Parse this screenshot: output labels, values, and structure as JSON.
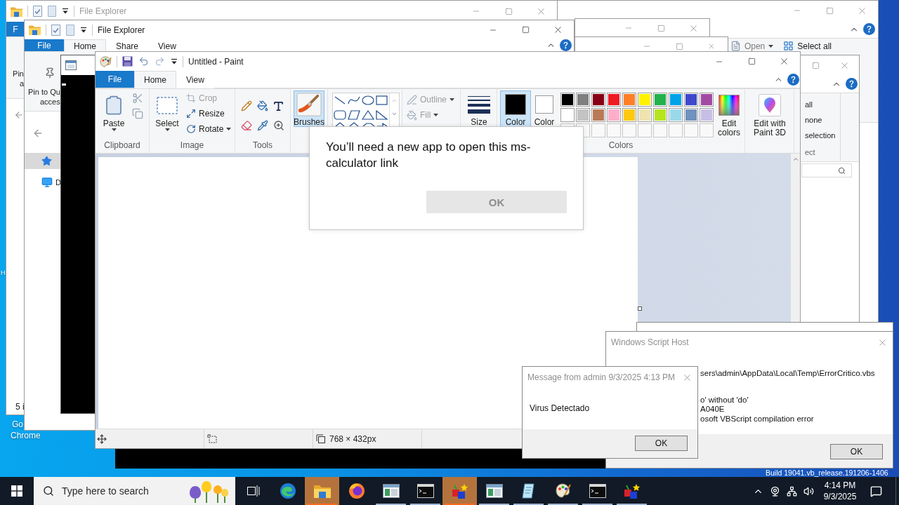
{
  "desktop": {
    "icon_labels": [
      {
        "lines": [
          "H"
        ]
      },
      {
        "lines": [
          "Go",
          "Chrome"
        ]
      }
    ],
    "build": "Build 19041.vb_release.191206-1406"
  },
  "explorer_right": {
    "ribbon": [
      {
        "kind": "open",
        "label": "Open",
        "disabled": true
      },
      {
        "kind": "select_all",
        "label": "Select all",
        "disabled": false
      }
    ]
  },
  "explorer_back": {
    "title": "File Explorer",
    "file_tab": "F",
    "pin_label": [
      "Pin",
      "a"
    ],
    "status": "5 i"
  },
  "explorer_side": {
    "select_items": [
      "all",
      "none",
      "selection"
    ],
    "group_label": "ect"
  },
  "explorer_front": {
    "title": "File Explorer",
    "file_tab": "File",
    "tabs": [
      {
        "label": "Home",
        "selected": true
      },
      {
        "label": "Share",
        "selected": false
      },
      {
        "label": "View",
        "selected": false
      }
    ],
    "pin_label": [
      "Pin to Qu",
      "acces"
    ],
    "nav_items": [
      {
        "kind": "quick_access",
        "selected": true
      },
      {
        "kind": "desktop",
        "label": "D",
        "selected": false
      }
    ]
  },
  "paint": {
    "title": "Untitled - Paint",
    "file_tab": "File",
    "tabs": [
      {
        "label": "Home",
        "selected": true
      },
      {
        "label": "View",
        "selected": false
      }
    ],
    "clipboard": {
      "paste": "Paste",
      "label": "Clipboard"
    },
    "image": {
      "select": "Select",
      "items": [
        {
          "kind": "crop",
          "label": "Crop",
          "disabled": true
        },
        {
          "kind": "resize",
          "label": "Resize",
          "disabled": false
        },
        {
          "kind": "rotate",
          "label": "Rotate",
          "disabled": false
        }
      ],
      "label": "Image"
    },
    "tools_label": "Tools",
    "brushes": {
      "label": "Brushes",
      "selected": true
    },
    "shape_options": [
      {
        "kind": "outline",
        "label": "Outline",
        "disabled": true
      },
      {
        "kind": "fill",
        "label": "Fill",
        "disabled": true
      }
    ],
    "size": "Size",
    "color_slots": [
      {
        "label": "Color",
        "selected": true,
        "color": "#000000"
      },
      {
        "label": "Color",
        "selected": false,
        "color": "#ffffff"
      }
    ],
    "palette": [
      {
        "color": "#000000"
      },
      {
        "color": "#7f7f7f"
      },
      {
        "color": "#880015"
      },
      {
        "color": "#ed1c24"
      },
      {
        "color": "#ff7f27"
      },
      {
        "color": "#fff200"
      },
      {
        "color": "#22b14c"
      },
      {
        "color": "#00a2e8"
      },
      {
        "color": "#3f48cc"
      },
      {
        "color": "#a349a4"
      },
      {
        "color": "#ffffff"
      },
      {
        "color": "#c3c3c3"
      },
      {
        "color": "#b97a57"
      },
      {
        "color": "#ffaec9"
      },
      {
        "color": "#ffc90e"
      },
      {
        "color": "#efe4b0"
      },
      {
        "color": "#b5e61d"
      },
      {
        "color": "#99d9ea"
      },
      {
        "color": "#7092be"
      },
      {
        "color": "#c8bfe7"
      }
    ],
    "colors_label": "Colors",
    "edit_colors": "Edit colors",
    "paint3d": "Edit with Paint 3D",
    "status_size": "768 × 432px"
  },
  "app_dialog": {
    "message": "You’ll need a new app to open this ms-calculator link",
    "button": "OK"
  },
  "script_host": {
    "title": "Windows Script Host",
    "lines": [
      "sers\\admin\\AppData\\Local\\Temp\\ErrorCritico.vbs",
      "o' without 'do'",
      "A040E",
      "osoft VBScript compilation error"
    ],
    "button": "OK"
  },
  "message_box": {
    "title": "Message from admin 9/3/2025 4:13 PM",
    "text": "Virus Detectado",
    "button": "OK"
  },
  "taskbar": {
    "search": {
      "placeholder": "Type here to search"
    },
    "apps": [
      {
        "kind": "edge",
        "highlighted": false,
        "running": false
      },
      {
        "kind": "folder",
        "highlighted": true,
        "running": true
      },
      {
        "kind": "firefox",
        "highlighted": false,
        "running": false
      },
      {
        "kind": "window",
        "highlighted": false,
        "running": true
      },
      {
        "kind": "terminal",
        "highlighted": false,
        "running": true
      },
      {
        "kind": "blocks",
        "highlighted": true,
        "running": true
      },
      {
        "kind": "window",
        "highlighted": false,
        "running": true
      },
      {
        "kind": "paper",
        "highlighted": false,
        "running": true
      },
      {
        "kind": "palette",
        "highlighted": false,
        "running": true
      },
      {
        "kind": "terminal",
        "highlighted": false,
        "running": true
      },
      {
        "kind": "blocks",
        "highlighted": false,
        "running": true
      }
    ],
    "clock": {
      "time": "4:14 PM",
      "date": "9/3/2025"
    }
  }
}
